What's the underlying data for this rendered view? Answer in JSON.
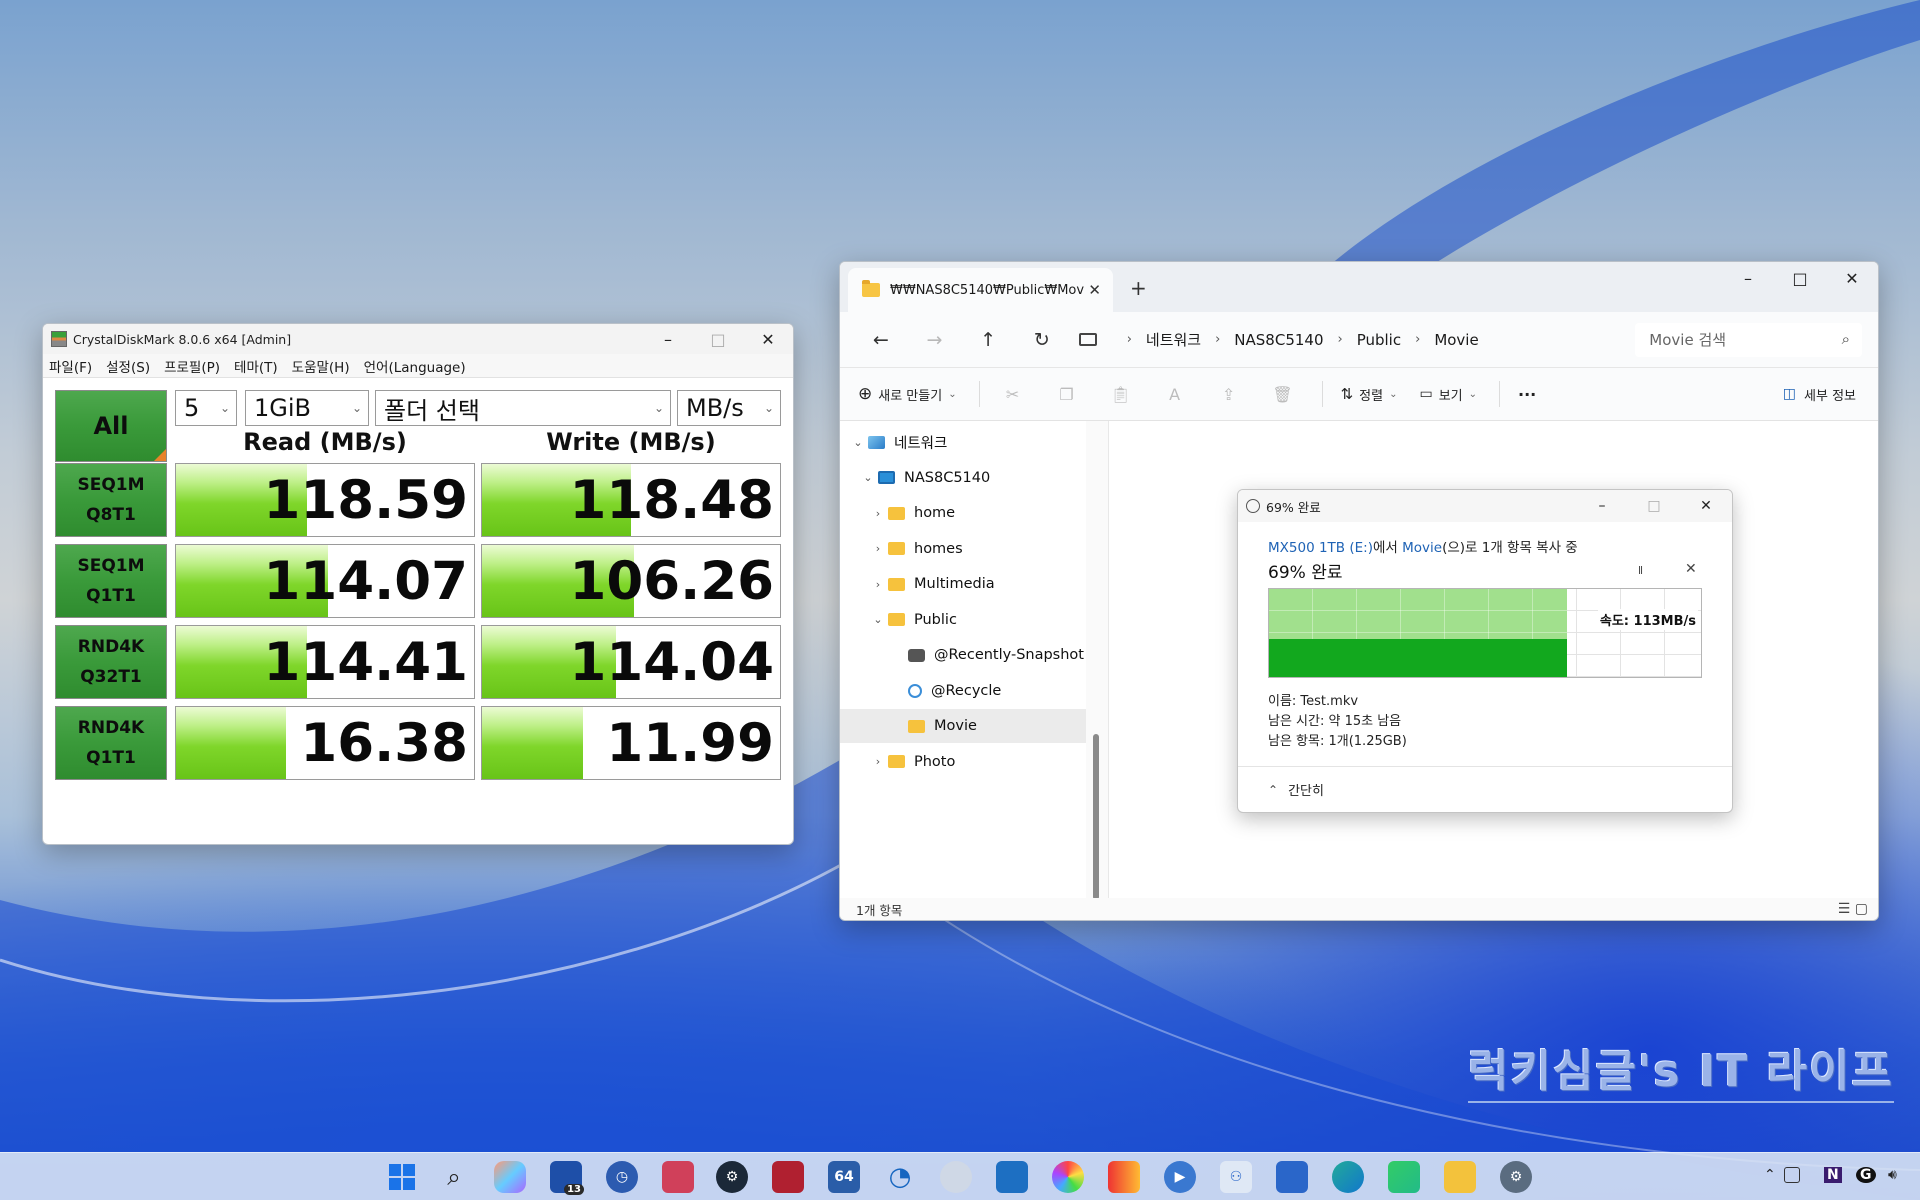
{
  "cdm": {
    "title": "CrystalDiskMark 8.0.6 x64 [Admin]",
    "menu": [
      "파일(F)",
      "설정(S)",
      "프로필(P)",
      "테마(T)",
      "도움말(H)",
      "언어(Language)"
    ],
    "all_label": "All",
    "count": "5",
    "size": "1GiB",
    "folder": "폴더 선택",
    "unit": "MB/s",
    "read_header": "Read (MB/s)",
    "write_header": "Write (MB/s)",
    "rows": [
      {
        "l1": "SEQ1M",
        "l2": "Q8T1",
        "read": "118.59",
        "write": "118.48",
        "read_fill": 0.44,
        "write_fill": 0.5
      },
      {
        "l1": "SEQ1M",
        "l2": "Q1T1",
        "read": "114.07",
        "write": "106.26",
        "read_fill": 0.51,
        "write_fill": 0.51
      },
      {
        "l1": "RND4K",
        "l2": "Q32T1",
        "read": "114.41",
        "write": "114.04",
        "read_fill": 0.44,
        "write_fill": 0.45
      },
      {
        "l1": "RND4K",
        "l2": "Q1T1",
        "read": "16.38",
        "write": "11.99",
        "read_fill": 0.37,
        "write_fill": 0.34
      }
    ]
  },
  "explorer": {
    "tab_title": "₩₩NAS8C5140₩Public₩Mov",
    "breadcrumbs": [
      "네트워크",
      "NAS8C5140",
      "Public",
      "Movie"
    ],
    "search_placeholder": "Movie 검색",
    "new_label": "새로 만들기",
    "sort_label": "정렬",
    "view_label": "보기",
    "more_label": "···",
    "details_label": "세부 정보",
    "tree": [
      {
        "label": "네트워크",
        "chev": "⌄",
        "icon": "net"
      },
      {
        "label": "NAS8C5140",
        "chev": "⌄",
        "icon": "pc"
      },
      {
        "label": "home",
        "chev": "›",
        "icon": "fold"
      },
      {
        "label": "homes",
        "chev": "›",
        "icon": "fold"
      },
      {
        "label": "Multimedia",
        "chev": "›",
        "icon": "fold"
      },
      {
        "label": "Public",
        "chev": "⌄",
        "icon": "fold"
      },
      {
        "label": "@Recently-Snapshot",
        "chev": "",
        "icon": "cam"
      },
      {
        "label": "@Recycle",
        "chev": "",
        "icon": "rec"
      },
      {
        "label": "Movie",
        "chev": "",
        "icon": "fold",
        "selected": true
      },
      {
        "label": "Photo",
        "chev": "›",
        "icon": "fold"
      }
    ],
    "status": "1개 항목"
  },
  "copy": {
    "title": "69% 완료",
    "src": "MX500 1TB (E:)",
    "mid": "에서 ",
    "dst": "Movie",
    "rest": "(으)로 1개 항목 복사 중",
    "percent_label": "69% 완료",
    "progress": 0.69,
    "speed_level": 0.43,
    "speed": "속도: 113MB/s",
    "name": "이름: Test.mkv",
    "remaining_time": "남은 시간: 약 15초 남음",
    "remaining_items": "남은 항목: 1개(1.25GB)",
    "collapse": "간단히"
  },
  "watermark": "럭키심글's IT 라이프",
  "taskbar": {
    "badge": "13",
    "app64": "64",
    "tray_n": "N",
    "tray_g": "G"
  }
}
